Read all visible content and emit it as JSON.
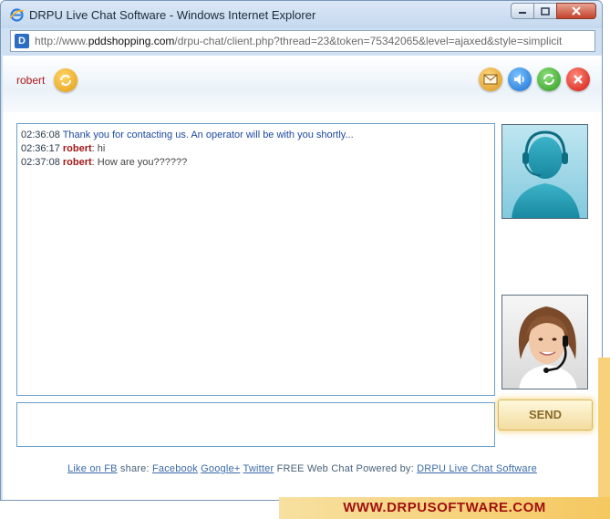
{
  "window": {
    "title": "DRPU Live Chat Software - Windows Internet Explorer",
    "url_prefix": "http://www.",
    "url_domain": "pddshopping.com",
    "url_rest": "/drpu-chat/client.php?thread=23&token=75342065&level=ajaxed&style=simplicit"
  },
  "header": {
    "user_name": "robert"
  },
  "chat": {
    "messages": [
      {
        "time": "02:36:08",
        "sender": "",
        "text": "Thank you for contacting us. An operator will be with you shortly..."
      },
      {
        "time": "02:36:17",
        "sender": "robert",
        "text": ": hi"
      },
      {
        "time": "02:37:08",
        "sender": "robert",
        "text": ": How are you??????"
      }
    ]
  },
  "composer": {
    "placeholder": "",
    "send_label": "SEND"
  },
  "footer": {
    "like_fb": "Like on FB",
    "share": " share: ",
    "facebook": "Facebook",
    "google": "Google+",
    "twitter": "Twitter",
    "powered": " FREE Web Chat Powered by: ",
    "drpu_link": "DRPU Live Chat Software"
  },
  "brand": {
    "banner": "WWW.DRPUSOFTWARE.COM"
  },
  "colors": {
    "accent_red": "#a01818",
    "operator_blue": "#1c4aa0",
    "border_blue": "#6aa0c9"
  }
}
